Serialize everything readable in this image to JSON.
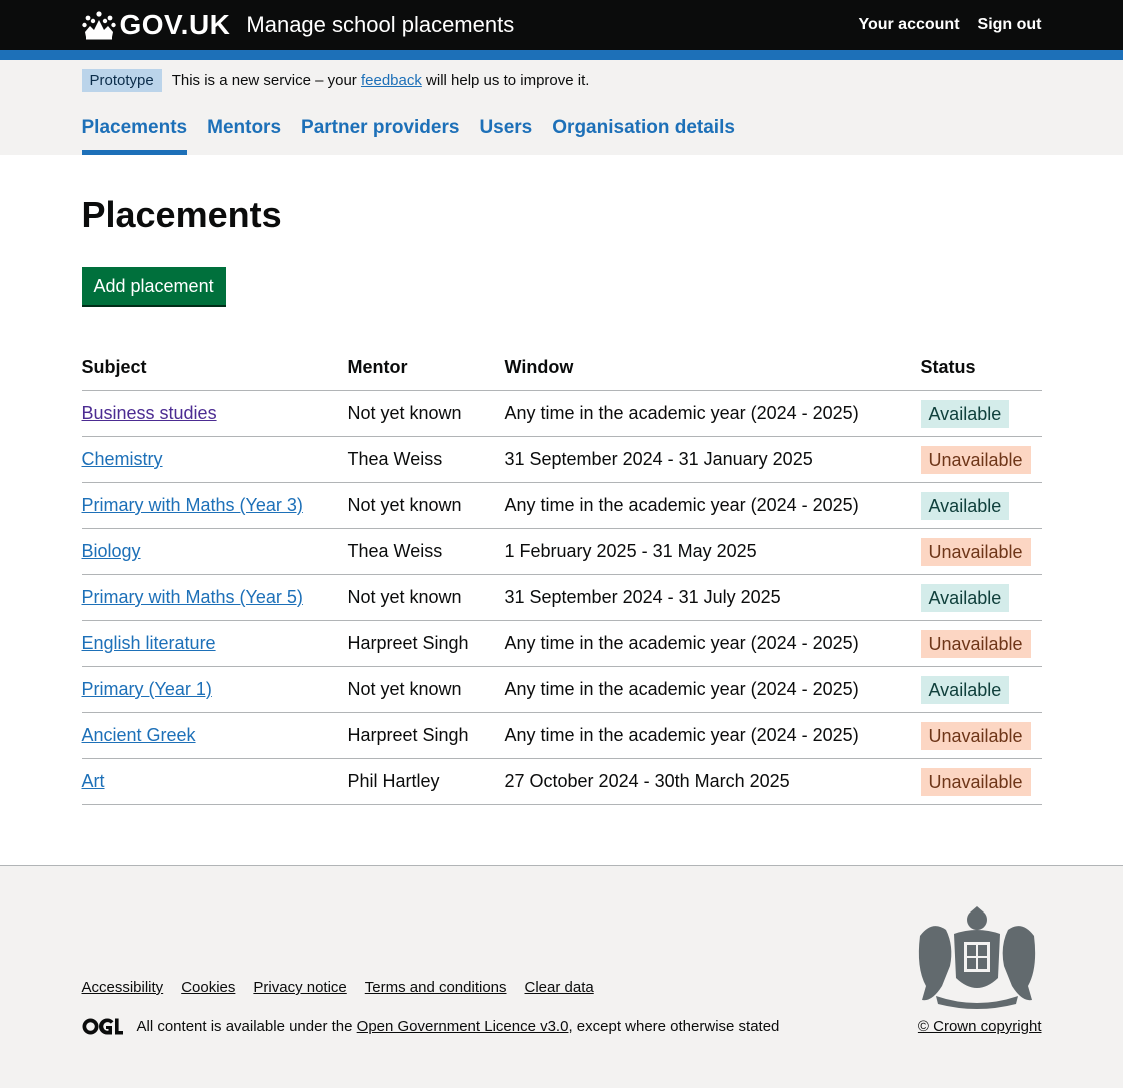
{
  "header": {
    "logo_text": "GOV.UK",
    "service_name": "Manage school placements",
    "account_link": "Your account",
    "signout_link": "Sign out"
  },
  "phase_banner": {
    "tag": "Prototype",
    "text_before": "This is a new service – your",
    "feedback_link": "feedback",
    "text_after": "will help us to improve it."
  },
  "nav": {
    "items": [
      {
        "label": "Placements",
        "active": true
      },
      {
        "label": "Mentors"
      },
      {
        "label": "Partner providers"
      },
      {
        "label": "Users"
      },
      {
        "label": "Organisation details"
      }
    ]
  },
  "main": {
    "title": "Placements",
    "add_button": "Add placement"
  },
  "table": {
    "headers": [
      "Subject",
      "Mentor",
      "Window",
      "Status"
    ],
    "rows": [
      {
        "subject": "Business studies",
        "mentor": "Not yet known",
        "window": "Any time in the academic year (2024 - 2025)",
        "status": "Available"
      },
      {
        "subject": "Chemistry",
        "mentor": "Thea Weiss",
        "window": "31 September 2024 - 31 January 2025",
        "status": "Unavailable"
      },
      {
        "subject": "Primary with Maths (Year 3)",
        "mentor": "Not yet known",
        "window": "Any time in the academic year (2024 - 2025)",
        "status": "Available"
      },
      {
        "subject": "Biology",
        "mentor": "Thea Weiss",
        "window": "1 February 2025 - 31 May 2025",
        "status": "Unavailable"
      },
      {
        "subject": "Primary with Maths (Year 5)",
        "mentor": "Not yet known",
        "window": "31 September 2024 - 31 July 2025",
        "status": "Available"
      },
      {
        "subject": "English literature",
        "mentor": "Harpreet Singh",
        "window": "Any time in the academic year (2024 - 2025)",
        "status": "Unavailable"
      },
      {
        "subject": "Primary (Year 1)",
        "mentor": "Not yet known",
        "window": "Any time in the academic year (2024 - 2025)",
        "status": "Available"
      },
      {
        "subject": "Ancient Greek",
        "mentor": "Harpreet Singh",
        "window": "Any time in the academic year (2024 - 2025)",
        "status": "Unavailable"
      },
      {
        "subject": "Art",
        "mentor": "Phil Hartley",
        "window": "27 October 2024 - 30th March 2025",
        "status": "Unavailable"
      }
    ]
  },
  "footer": {
    "links": [
      "Accessibility",
      "Cookies",
      "Privacy notice",
      "Terms and conditions",
      "Clear data"
    ],
    "licence_before": "All content is available under the",
    "licence_link": "Open Government Licence v3.0",
    "licence_after": ", except where otherwise stated",
    "copyright": "© Crown copyright"
  }
}
